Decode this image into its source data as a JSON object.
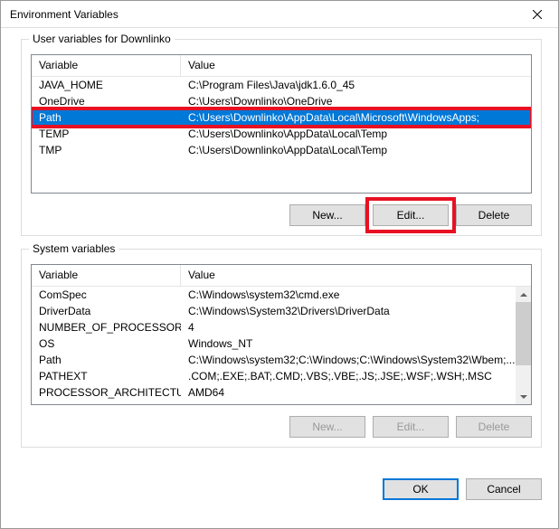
{
  "window": {
    "title": "Environment Variables"
  },
  "user_section": {
    "title": "User variables for Downlinko",
    "columns": {
      "variable": "Variable",
      "value": "Value"
    },
    "rows": [
      {
        "variable": "JAVA_HOME",
        "value": "C:\\Program Files\\Java\\jdk1.6.0_45"
      },
      {
        "variable": "OneDrive",
        "value": "C:\\Users\\Downlinko\\OneDrive"
      },
      {
        "variable": "Path",
        "value": "C:\\Users\\Downlinko\\AppData\\Local\\Microsoft\\WindowsApps;"
      },
      {
        "variable": "TEMP",
        "value": "C:\\Users\\Downlinko\\AppData\\Local\\Temp"
      },
      {
        "variable": "TMP",
        "value": "C:\\Users\\Downlinko\\AppData\\Local\\Temp"
      }
    ],
    "selected_index": 2,
    "buttons": {
      "new": "New...",
      "edit": "Edit...",
      "delete": "Delete"
    }
  },
  "system_section": {
    "title": "System variables",
    "columns": {
      "variable": "Variable",
      "value": "Value"
    },
    "rows": [
      {
        "variable": "ComSpec",
        "value": "C:\\Windows\\system32\\cmd.exe"
      },
      {
        "variable": "DriverData",
        "value": "C:\\Windows\\System32\\Drivers\\DriverData"
      },
      {
        "variable": "NUMBER_OF_PROCESSORS",
        "value": "4"
      },
      {
        "variable": "OS",
        "value": "Windows_NT"
      },
      {
        "variable": "Path",
        "value": "C:\\Windows\\system32;C:\\Windows;C:\\Windows\\System32\\Wbem;..."
      },
      {
        "variable": "PATHEXT",
        "value": ".COM;.EXE;.BAT;.CMD;.VBS;.VBE;.JS;.JSE;.WSF;.WSH;.MSC"
      },
      {
        "variable": "PROCESSOR_ARCHITECTURE",
        "value": "AMD64"
      }
    ],
    "buttons": {
      "new": "New...",
      "edit": "Edit...",
      "delete": "Delete"
    }
  },
  "dialog_buttons": {
    "ok": "OK",
    "cancel": "Cancel"
  },
  "highlights": {
    "selected_row": true,
    "edit_button": true
  }
}
